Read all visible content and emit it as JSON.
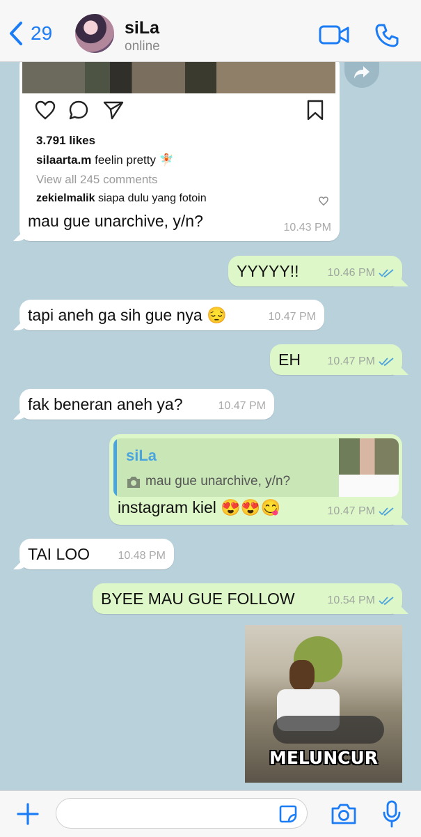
{
  "header": {
    "back_count": "29",
    "contact_name": "siLa",
    "contact_status": "online"
  },
  "instagram_post": {
    "likes": "3.791 likes",
    "caption_user": "silaarta.m",
    "caption_text": "feelin pretty 🧚🏻",
    "view_comments": "View all 245 comments",
    "comment_user": "zekielmalik",
    "comment_text": "siapa dulu yang fotoin"
  },
  "messages": [
    {
      "text": "mau gue unarchive, y/n?",
      "time": "10.43 PM"
    },
    {
      "text": "YYYYY!!",
      "time": "10.46 PM"
    },
    {
      "text": "tapi aneh ga sih gue nya 😔",
      "time": "10.47 PM"
    },
    {
      "text": "EH",
      "time": "10.47 PM"
    },
    {
      "text": "fak beneran aneh ya?",
      "time": "10.47 PM"
    },
    {
      "text": "instagram kiel 😍😍😋",
      "time": "10.47 PM"
    },
    {
      "text": "TAI LOO",
      "time": "10.48 PM"
    },
    {
      "text": "BYEE MAU GUE FOLLOW",
      "time": "10.54 PM"
    }
  ],
  "reply": {
    "name": "siLa",
    "text": "mau gue unarchive, y/n?"
  },
  "meme": {
    "caption": "MELUNCUR"
  },
  "colors": {
    "accent": "#1b7cf5",
    "chat_bg": "#b9d1db",
    "outgoing_bubble": "#ddf7c8",
    "read_ticks": "#4ea4dc"
  },
  "icons": [
    "chevron-left-icon",
    "video-call-icon",
    "phone-icon",
    "heart-icon",
    "comment-icon",
    "share-icon",
    "bookmark-icon",
    "forward-icon",
    "camera-icon",
    "plus-icon",
    "sticker-icon",
    "microphone-icon"
  ]
}
